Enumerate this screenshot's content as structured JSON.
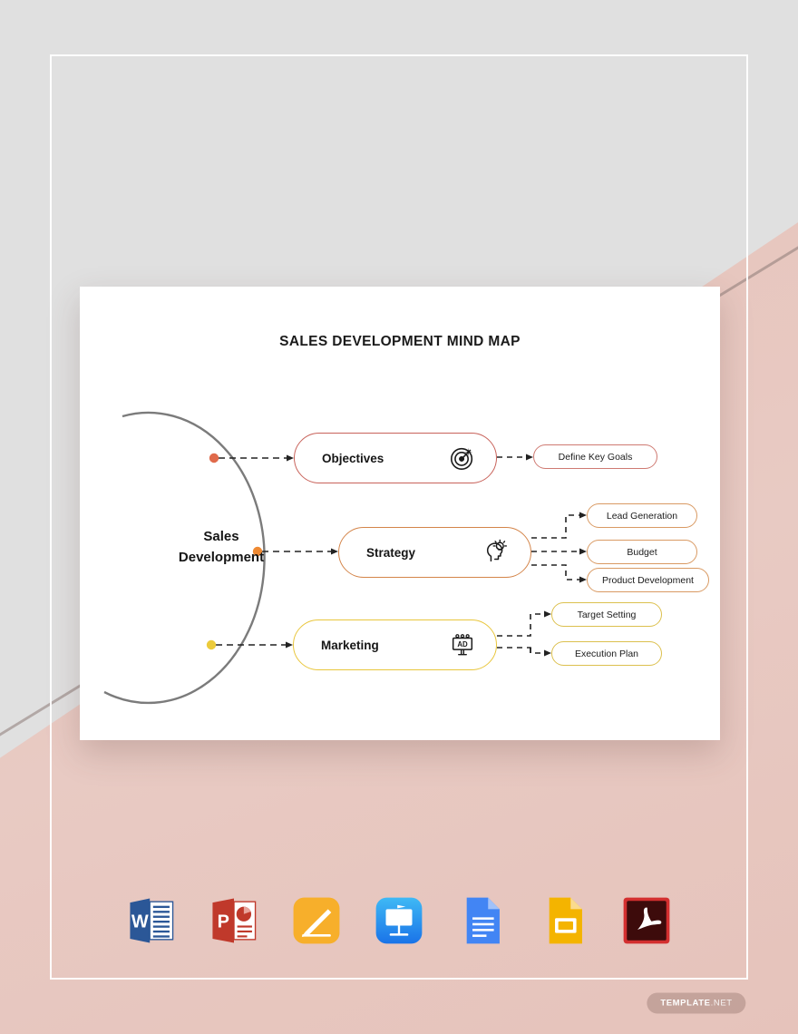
{
  "document": {
    "title": "SALES DEVELOPMENT MIND MAP",
    "center_node": {
      "line1": "Sales",
      "line2": "Development"
    }
  },
  "colors": {
    "objectives": "#c8625a",
    "strategy": "#d4854a",
    "marketing": "#e9c63c",
    "arc": "#7b7b7b",
    "page_grey": "#e0e0e0",
    "page_pink": "#e6c3bb",
    "card": "#ffffff",
    "title_text": "#1b1b1b"
  },
  "branches": [
    {
      "id": "objectives",
      "label": "Objectives",
      "icon": "target-icon",
      "dot_color": "#e06a4b",
      "children": [
        {
          "label": "Define Key Goals"
        }
      ]
    },
    {
      "id": "strategy",
      "label": "Strategy",
      "icon": "idea-head-icon",
      "dot_color": "#ef8a33",
      "children": [
        {
          "label": "Lead Generation"
        },
        {
          "label": "Budget"
        },
        {
          "label": "Product Development"
        }
      ]
    },
    {
      "id": "marketing",
      "label": "Marketing",
      "icon": "ad-billboard-icon",
      "dot_color": "#eccb3b",
      "children": [
        {
          "label": "Target Setting"
        },
        {
          "label": "Execution Plan"
        }
      ]
    }
  ],
  "file_formats": [
    {
      "name": "Microsoft Word",
      "icon": "word-icon"
    },
    {
      "name": "Microsoft PowerPoint",
      "icon": "powerpoint-icon"
    },
    {
      "name": "Apple Pages",
      "icon": "pages-icon"
    },
    {
      "name": "Apple Keynote",
      "icon": "keynote-icon"
    },
    {
      "name": "Google Docs",
      "icon": "google-docs-icon"
    },
    {
      "name": "Google Slides",
      "icon": "google-slides-icon"
    },
    {
      "name": "PDF",
      "icon": "pdf-icon"
    }
  ],
  "watermark": {
    "bold": "TEMPLATE",
    "dim": ".NET"
  }
}
